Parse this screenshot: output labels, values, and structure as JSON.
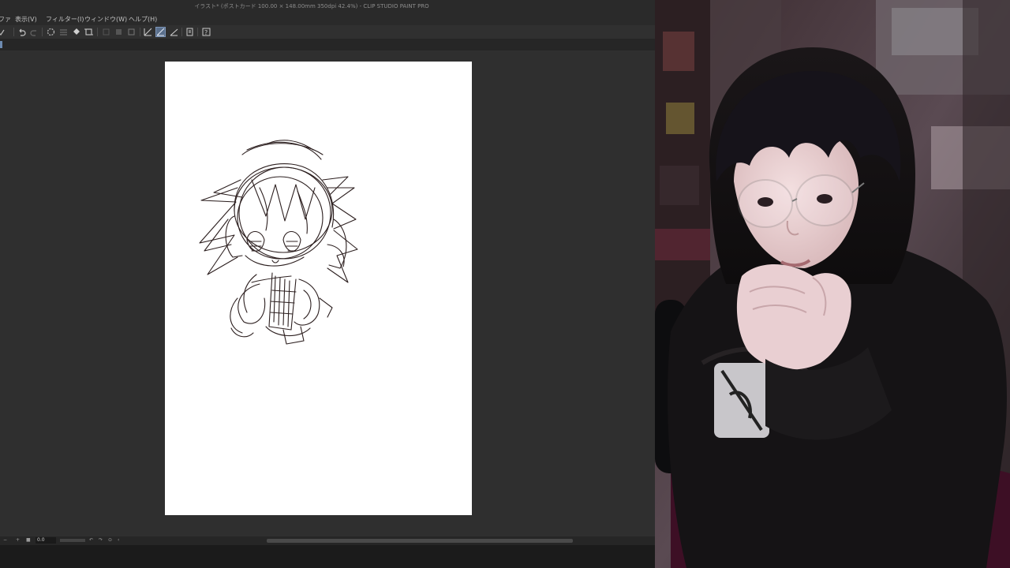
{
  "window": {
    "title": "イラスト* (ポストカード 100.00 × 148.00mm 350dpi 42.4%) - CLIP STUDIO PAINT PRO"
  },
  "menu": [
    {
      "label": "ファ"
    },
    {
      "label": "表示(V)"
    },
    {
      "label": "フィルター(I)"
    },
    {
      "label": "ウィンドウ(W)"
    },
    {
      "label": "ヘルプ(H)"
    }
  ],
  "toolbar": {
    "icons": [
      "undo-icon",
      "redo-icon",
      "loading-spinner-icon",
      "fill-bucket-icon",
      "crop-icon",
      "clear-icon",
      "fill-icon",
      "transform-icon",
      "pen-stroke-icon",
      "pen-stroke-active-icon",
      "pen-stroke-alt-icon",
      "layer-property-icon",
      "help-icon"
    ],
    "active_tool": "pen-stroke-active-icon"
  },
  "status": {
    "zoom_value": "0.0"
  },
  "colors": {
    "accent": "#6d8ab0",
    "canvas_bg": "#2f2f2f",
    "sketch_stroke": "#1b0d0d",
    "page": "#ffffff"
  }
}
